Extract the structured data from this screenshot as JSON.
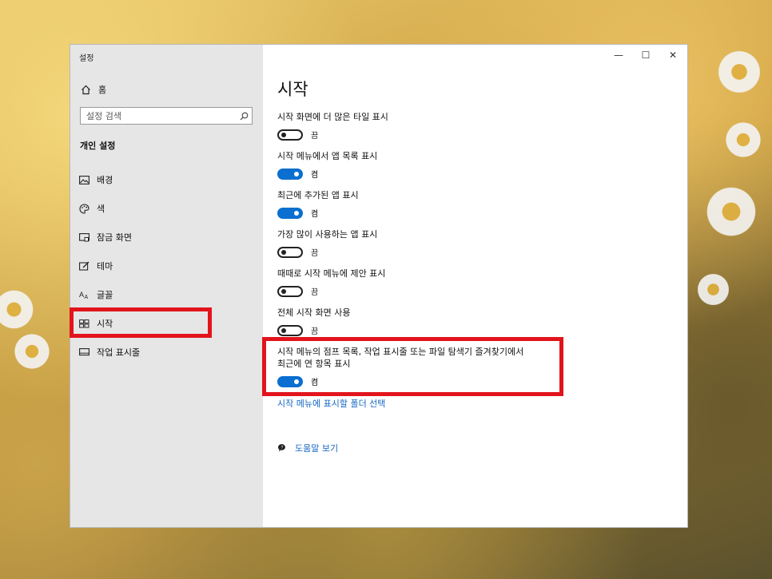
{
  "window": {
    "title": "설정",
    "controls": {
      "minimize": "—",
      "maximize": "☐",
      "close": "✕"
    }
  },
  "sidebar": {
    "home_label": "홈",
    "search_placeholder": "설정 검색",
    "section_title": "개인 설정",
    "items": [
      {
        "label": "배경",
        "icon": "image-icon"
      },
      {
        "label": "색",
        "icon": "palette-icon"
      },
      {
        "label": "잠금 화면",
        "icon": "lock-screen-icon"
      },
      {
        "label": "테마",
        "icon": "theme-icon"
      },
      {
        "label": "글꼴",
        "icon": "font-icon"
      },
      {
        "label": "시작",
        "icon": "start-icon",
        "selected": true
      },
      {
        "label": "작업 표시줄",
        "icon": "taskbar-icon"
      }
    ]
  },
  "main": {
    "title": "시작",
    "settings": [
      {
        "label": "시작 화면에 더 많은 타일 표시",
        "on": false,
        "state": "끔"
      },
      {
        "label": "시작 메뉴에서 앱 목록 표시",
        "on": true,
        "state": "켬"
      },
      {
        "label": "최근에 추가된 앱 표시",
        "on": true,
        "state": "켬"
      },
      {
        "label": "가장 많이 사용하는 앱 표시",
        "on": false,
        "state": "끔"
      },
      {
        "label": "때때로 시작 메뉴에 제안 표시",
        "on": false,
        "state": "끔"
      },
      {
        "label": "전체 시작 화면 사용",
        "on": false,
        "state": "끔"
      },
      {
        "label_line1": "시작 메뉴의 점프 목록, 작업 표시줄 또는 파일 탐색기 즐겨찾기에서",
        "label_line2": "최근에 연 항목 표시",
        "on": true,
        "state": "켬"
      }
    ],
    "folder_link": "시작 메뉴에 표시할 폴더 선택",
    "help_link": "도움말 보기"
  },
  "colors": {
    "accent": "#0a6fd0",
    "highlight": "#e2141c",
    "link": "#1767c2",
    "sidebar_bg": "#e6e6e6"
  }
}
